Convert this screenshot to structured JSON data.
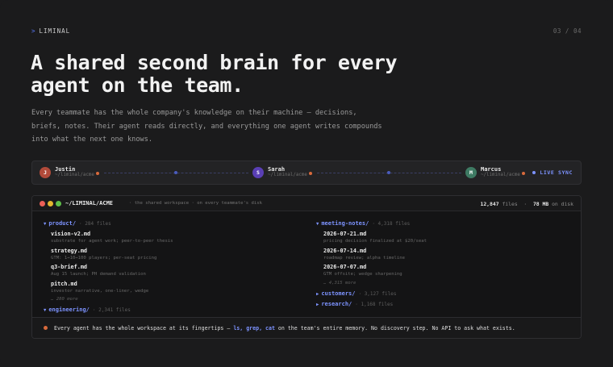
{
  "header": {
    "brand": "LIMINAL",
    "brand_caret": ">",
    "pager": "03 / 04"
  },
  "hero": {
    "headline_line1": "A shared second brain for every",
    "headline_line2": "agent on the team.",
    "lede_line1": "Every teammate has the whole company's knowledge on their machine — decisions,",
    "lede_line2": "briefs, notes. Their agent reads directly, and everything one agent writes compounds",
    "lede_line3": "into what the next one knows."
  },
  "sync": {
    "members": [
      {
        "initial": "J",
        "name": "Justin",
        "path": "~/liminal/acme",
        "color": "#b14a3a"
      },
      {
        "initial": "S",
        "name": "Sarah",
        "path": "~/liminal/acme",
        "color": "#5a3fb5"
      },
      {
        "initial": "M",
        "name": "Marcus",
        "path": "~/liminal/acme",
        "color": "#3e7a63"
      }
    ],
    "status": "LIVE SYNC"
  },
  "window": {
    "title": "~/LIMINAL/ACME",
    "subtitle": "·  the shared workspace  ·  on every teammate's disk",
    "files_count": "12,847",
    "files_label": "files",
    "sep": "·",
    "disk_size": "78 MB",
    "disk_label": "on disk",
    "left": {
      "folder": "product/",
      "count": "· 284 files",
      "files": [
        {
          "name": "vision-v2.md",
          "desc": "substrate for agent work; peer-to-peer thesis"
        },
        {
          "name": "strategy.md",
          "desc": "GTM: 1→10→100 players; per-seat pricing"
        },
        {
          "name": "q3-brief.md",
          "desc": "Aug 15 launch; PH demand validation"
        },
        {
          "name": "pitch.md",
          "desc": "investor narrative, one-liner, wedge"
        }
      ],
      "more": "… 280 more",
      "folder2": "engineering/",
      "count2": "· 2,341 files"
    },
    "right": {
      "folder": "meeting-notes/",
      "count": "· 4,318 files",
      "files": [
        {
          "name": "2026-07-21.md",
          "desc": "pricing decision finalized at $20/seat"
        },
        {
          "name": "2026-07-14.md",
          "desc": "roadmap review; alpha timeline"
        },
        {
          "name": "2026-07-07.md",
          "desc": "GTM offsite; wedge sharpening"
        }
      ],
      "more": "… 4,315 more",
      "folder2": "customers/",
      "count2": "· 3,127 files",
      "folder3": "research/",
      "count3": "· 1,168 files"
    },
    "footer": {
      "pre": "Every agent has the whole workspace at its fingertips —",
      "cmds": "ls, grep, cat",
      "post": "on the team's entire memory. No discovery step. No API to ask what exists."
    }
  }
}
